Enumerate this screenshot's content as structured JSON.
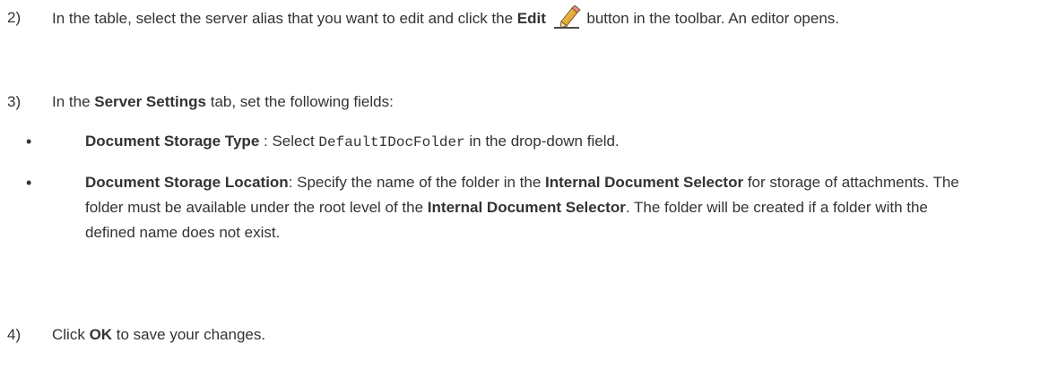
{
  "steps": [
    {
      "number": "2)",
      "t1": "In the table, select the server alias that you want to edit and click the ",
      "b1": "Edit",
      "icon": "pencil-edit-icon",
      "t2": " button in the toolbar. An editor opens."
    },
    {
      "number": "3)",
      "t1": "In the ",
      "b1": "Server Settings",
      "t2": " tab, set the following fields:"
    },
    {
      "number": "4)",
      "t1": "Click ",
      "b1": "OK",
      "t2": " to save your changes."
    }
  ],
  "bullets": [
    {
      "dot": "•",
      "b1": "Document Storage Type",
      "t1": " : Select ",
      "code": "DefaultIDocFolder",
      "t2": " in the drop-down field."
    },
    {
      "dot": "•",
      "b1": "Document Storage Location",
      "t1": ": Specify the name of the folder in the ",
      "b2": "Internal Document Selector",
      "t2": " for storage of attachments. The folder must be available under the root level of the ",
      "b3": "Internal Document Selector",
      "t3": ". The folder will be created if a folder with the defined name does not exist."
    }
  ]
}
